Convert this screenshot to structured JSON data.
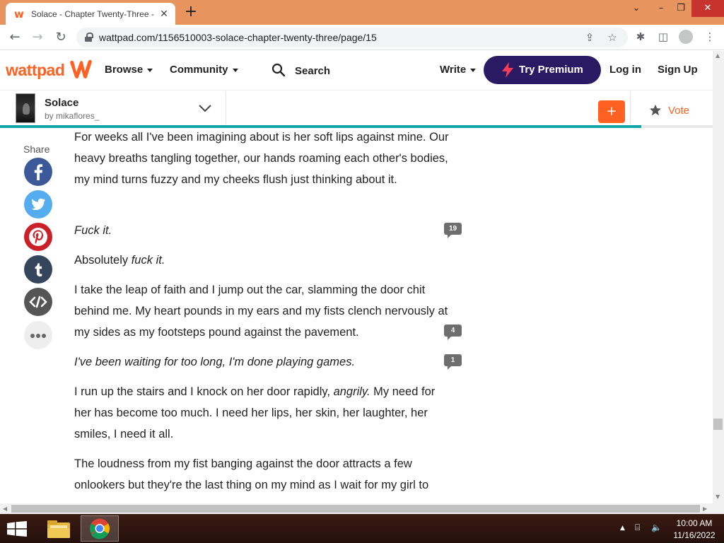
{
  "browser": {
    "tab_title": "Solace - Chapter Twenty-Three -",
    "tab_close": "✕",
    "new_tab": "+",
    "url": "wattpad.com/1156510003-solace-chapter-twenty-three/page/15"
  },
  "header": {
    "logo_text": "wattpad",
    "browse_label": "Browse",
    "community_label": "Community",
    "search_label": "Search",
    "write_label": "Write",
    "premium_label": "Try Premium",
    "login_label": "Log in",
    "signup_label": "Sign Up"
  },
  "story": {
    "title": "Solace",
    "author": "by mikaflores_",
    "add_label": "+",
    "vote_label": "Vote",
    "reading_progress": 0.9
  },
  "share": {
    "label": "Share",
    "icons": [
      "facebook-icon",
      "twitter-icon",
      "pinterest-icon",
      "tumblr-icon",
      "embed-icon",
      "more-icon"
    ]
  },
  "content": {
    "paragraphs": [
      {
        "text": "For weeks all I've been imagining about is her soft lips against mine. Our heavy breaths tangling together, our hands roaming each other's bodies, my mind turns fuzzy and my cheeks flush just thinking about it.",
        "comments": ""
      },
      {
        "text": "Fuck it.",
        "comments": "19"
      },
      {
        "text_plain": "Absolutely ",
        "text_italic": "fuck it.",
        "comments": ""
      },
      {
        "text": "I take the leap of faith and I jump out the car, slamming the door chit behind me. My heart pounds in my ears and my fists clench nervously at my sides as my footsteps pound against the pavement.",
        "comments": "4"
      },
      {
        "text": "I've been waiting for too long, I'm done playing games.",
        "comments": "1"
      },
      {
        "text_plain": "I run up the stairs and I knock on her door rapidly, ",
        "text_italic": "angrily.",
        "text_after": " My need for her has become too much. I need her lips, her skin, her laughter, her smiles, I need it all.",
        "comments": ""
      },
      {
        "text": "The loudness from my fist banging against the door attracts a few onlookers but they're the last thing on my mind as I wait for my girl to",
        "comments": ""
      }
    ]
  },
  "taskbar": {
    "time": "10:00 AM",
    "date": "11/16/2022"
  },
  "colors": {
    "brand": "#ff6122",
    "premium": "#2a1a63",
    "progress": "#11a5a5",
    "facebook": "#3b5998",
    "twitter": "#55acee",
    "pinterest": "#cb2027",
    "tumblr": "#35465c",
    "embed": "#555555",
    "more": "#eeeeee"
  }
}
